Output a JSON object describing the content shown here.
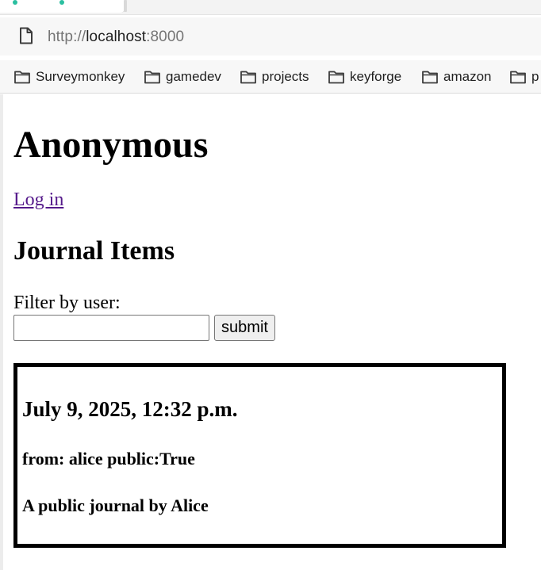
{
  "browser": {
    "url_scheme": "http://",
    "url_host": "localhost",
    "url_port": ":8000",
    "bookmarks": [
      {
        "label": "Surveymonkey",
        "icon": "folder-icon"
      },
      {
        "label": "gamedev",
        "icon": "folder-icon"
      },
      {
        "label": "projects",
        "icon": "folder-icon"
      },
      {
        "label": "keyforge",
        "icon": "folder-icon"
      },
      {
        "label": "amazon",
        "icon": "folder-icon"
      },
      {
        "label": "p",
        "icon": "folder-icon"
      }
    ],
    "colors": {
      "tab_indicator": "#2bbfa0",
      "visited_link": "#551a8b"
    }
  },
  "page": {
    "username": "Anonymous",
    "login_link": "Log in",
    "section_title": "Journal Items",
    "filter": {
      "label": "Filter by user:",
      "value": "",
      "submit_label": "submit"
    },
    "journal_items": [
      {
        "date": "July 9, 2025, 12:32 p.m.",
        "meta": "from: alice public:True",
        "text": "A public journal by Alice"
      }
    ]
  }
}
